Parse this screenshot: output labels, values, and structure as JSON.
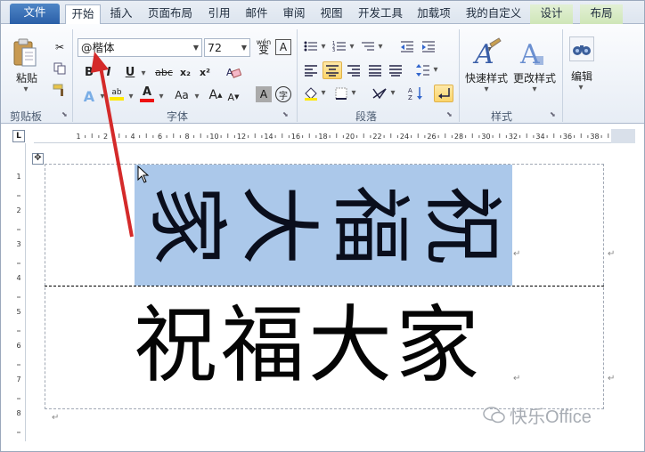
{
  "tabs": [
    "文件",
    "开始",
    "插入",
    "页面布局",
    "引用",
    "邮件",
    "审阅",
    "视图",
    "开发工具",
    "加载项",
    "我的自定义",
    "设计",
    "布局"
  ],
  "clipboard": {
    "paste_label": "粘贴",
    "group_label": "剪贴板"
  },
  "font": {
    "name_value": "@楷体",
    "size_value": "72",
    "group_label": "字体",
    "bold": "B",
    "italic": "I",
    "underline": "U",
    "strike": "abc",
    "subscript": "x₂",
    "superscript": "x²",
    "grow": "A",
    "shrink": "A",
    "aa": "Aa",
    "wen": "wén",
    "char_border": "A",
    "char_shade": "A",
    "enclose": "字"
  },
  "paragraph": {
    "group_label": "段落"
  },
  "styles": {
    "quick_label": "快速样式",
    "change_label": "更改样式",
    "group_label": "样式"
  },
  "editing": {
    "label": "编辑"
  },
  "ruler": {
    "h_numbers": [
      "1",
      "2",
      "4",
      "6",
      "8",
      "10",
      "12",
      "14",
      "16",
      "18",
      "20",
      "22",
      "24",
      "26",
      "28",
      "30",
      "32",
      "34",
      "36",
      "38"
    ],
    "v_numbers": [
      "1",
      "2",
      "3",
      "4",
      "5",
      "6",
      "7",
      "8",
      "9"
    ]
  },
  "document": {
    "rotated_chars": [
      "家",
      "大",
      "福",
      "祝"
    ],
    "normal_text": "祝福大家",
    "para_mark": "↵"
  },
  "watermark": "快乐Office",
  "colors": {
    "accent": "#2a5fa8",
    "selection": "#abc8ea",
    "arrow": "#d42a2a"
  }
}
